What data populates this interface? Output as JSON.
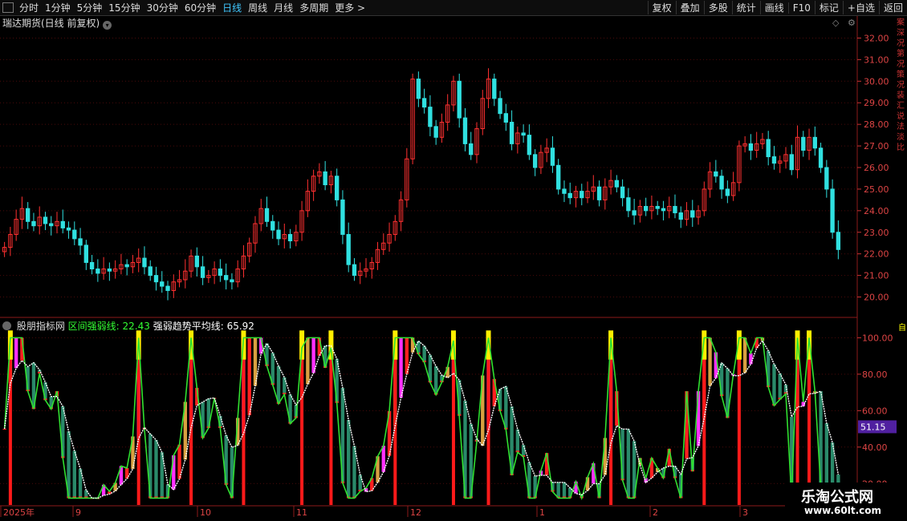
{
  "toolbar": {
    "left_items": [
      "分时",
      "1分钟",
      "5分钟",
      "15分钟",
      "30分钟",
      "60分钟",
      "日线",
      "周线",
      "月线",
      "多周期",
      "更多 >"
    ],
    "active": "日线",
    "right_items": [
      "复权",
      "叠加",
      "多股",
      "统计",
      "画线",
      "F10",
      "标记",
      "+自选",
      "返回"
    ]
  },
  "main_chart": {
    "title": "瑞达期货(日线 前复权)",
    "y_ticks": [
      "32.00",
      "31.00",
      "30.00",
      "29.00",
      "28.00",
      "27.00",
      "26.00",
      "25.00",
      "24.00",
      "23.00",
      "22.00",
      "21.00",
      "20.00"
    ]
  },
  "indicator": {
    "name": "股朋指标网",
    "line1_label": "区间强弱线: 22.43",
    "line2_label": "强弱趋势平均线: 65.92",
    "y_ticks": [
      "100.00",
      "80.00",
      "60.00",
      "40.00",
      "20.00"
    ],
    "current_value": "51.15"
  },
  "x_axis": {
    "labels": [
      "2025年",
      "9",
      "10",
      "11",
      "12",
      "1",
      "2",
      "3"
    ]
  },
  "watermark": {
    "line1": "乐淘公式网",
    "line2": "www.60lt.com"
  },
  "edge_text": "案深况第况策况装汇说法淡比",
  "colors": {
    "up": "#ff3030",
    "down": "#30e0e0",
    "accent": "#40c8ff"
  },
  "chart_data": {
    "type": "candlestick",
    "ylim": [
      19.5,
      32.5
    ],
    "closes": [
      22.3,
      22.9,
      23.6,
      24.1,
      23.5,
      23.3,
      23.7,
      23.4,
      23.3,
      23.5,
      23.2,
      23.1,
      22.7,
      22.4,
      21.6,
      21.3,
      21.1,
      21.3,
      21.2,
      21.3,
      21.5,
      21.4,
      21.6,
      21.8,
      21.4,
      21.0,
      20.7,
      20.5,
      20.3,
      20.7,
      20.8,
      21.2,
      21.9,
      21.4,
      20.9,
      21.0,
      21.3,
      21.0,
      20.8,
      20.7,
      21.3,
      21.9,
      22.5,
      23.4,
      24.1,
      23.5,
      23.1,
      22.7,
      22.9,
      22.6,
      23.0,
      24.0,
      24.9,
      25.6,
      25.8,
      25.2,
      25.6,
      24.5,
      22.9,
      21.5,
      21.0,
      21.2,
      21.3,
      21.6,
      22.2,
      22.5,
      22.9,
      23.5,
      24.5,
      26.4,
      30.1,
      29.2,
      28.8,
      27.9,
      27.4,
      28.1,
      28.9,
      30.0,
      28.3,
      27.1,
      26.6,
      27.8,
      29.2,
      30.1,
      29.2,
      28.5,
      28.1,
      27.1,
      27.6,
      27.5,
      26.6,
      26.0,
      26.7,
      26.9,
      26.1,
      25.0,
      24.8,
      24.6,
      24.9,
      24.6,
      24.9,
      25.1,
      24.5,
      25.1,
      25.4,
      25.1,
      24.6,
      24.0,
      23.8,
      24.2,
      24.0,
      24.2,
      24.1,
      24.0,
      24.2,
      23.9,
      23.6,
      24.0,
      23.7,
      24.0,
      25.0,
      25.8,
      25.6,
      25.0,
      24.7,
      25.3,
      27.0,
      27.1,
      26.8,
      27.1,
      27.3,
      26.5,
      26.2,
      26.3,
      26.6,
      25.9,
      27.4,
      26.8,
      27.4,
      26.9,
      26.0,
      25.0,
      23.0,
      22.2
    ],
    "indicator_strength_line_last": 22.43,
    "indicator_trend_avg_last": 65.92,
    "indicator_ylim": [
      10,
      105
    ]
  }
}
